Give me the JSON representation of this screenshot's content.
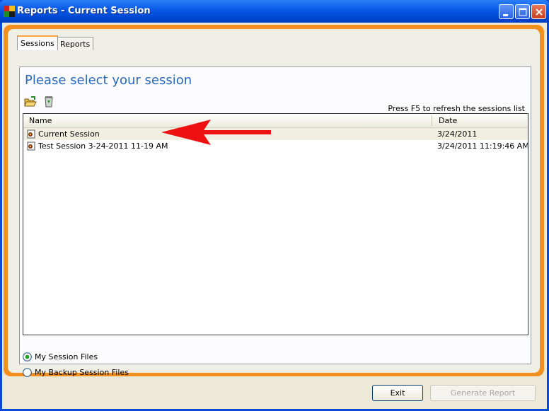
{
  "window": {
    "title": "Reports - Current Session",
    "icons": {
      "app": "app-logo-icon",
      "minimize": "minimize-icon",
      "maximize": "maximize-icon",
      "close": "close-icon"
    }
  },
  "tabs": [
    {
      "label": "Sessions",
      "active": true
    },
    {
      "label": "Reports",
      "active": false
    }
  ],
  "sessions_page": {
    "heading": "Please select your session",
    "toolbar": {
      "open_icon": "open-folder-icon",
      "delete_icon": "recycle-bin-icon"
    },
    "refresh_hint": "Press F5 to refresh the sessions list",
    "columns": [
      "Name",
      "Date"
    ],
    "rows": [
      {
        "name": "Current Session",
        "date": "3/24/2011",
        "selected": true,
        "icon": "session-icon"
      },
      {
        "name": "Test Session 3-24-2011 11-19 AM",
        "date": "3/24/2011 11:19:46 AM",
        "selected": false,
        "icon": "session-icon"
      }
    ],
    "annotation": "red-arrow-icon",
    "source_options": [
      {
        "label": "My Session Files",
        "checked": true
      },
      {
        "label": "My Backup Session Files",
        "checked": false
      }
    ]
  },
  "footer": {
    "exit_label": "Exit",
    "generate_label": "Generate Report"
  },
  "colors": {
    "accent_orange": "#f28f1e",
    "heading_blue": "#2868bd",
    "arrow_red": "#ee1111"
  }
}
